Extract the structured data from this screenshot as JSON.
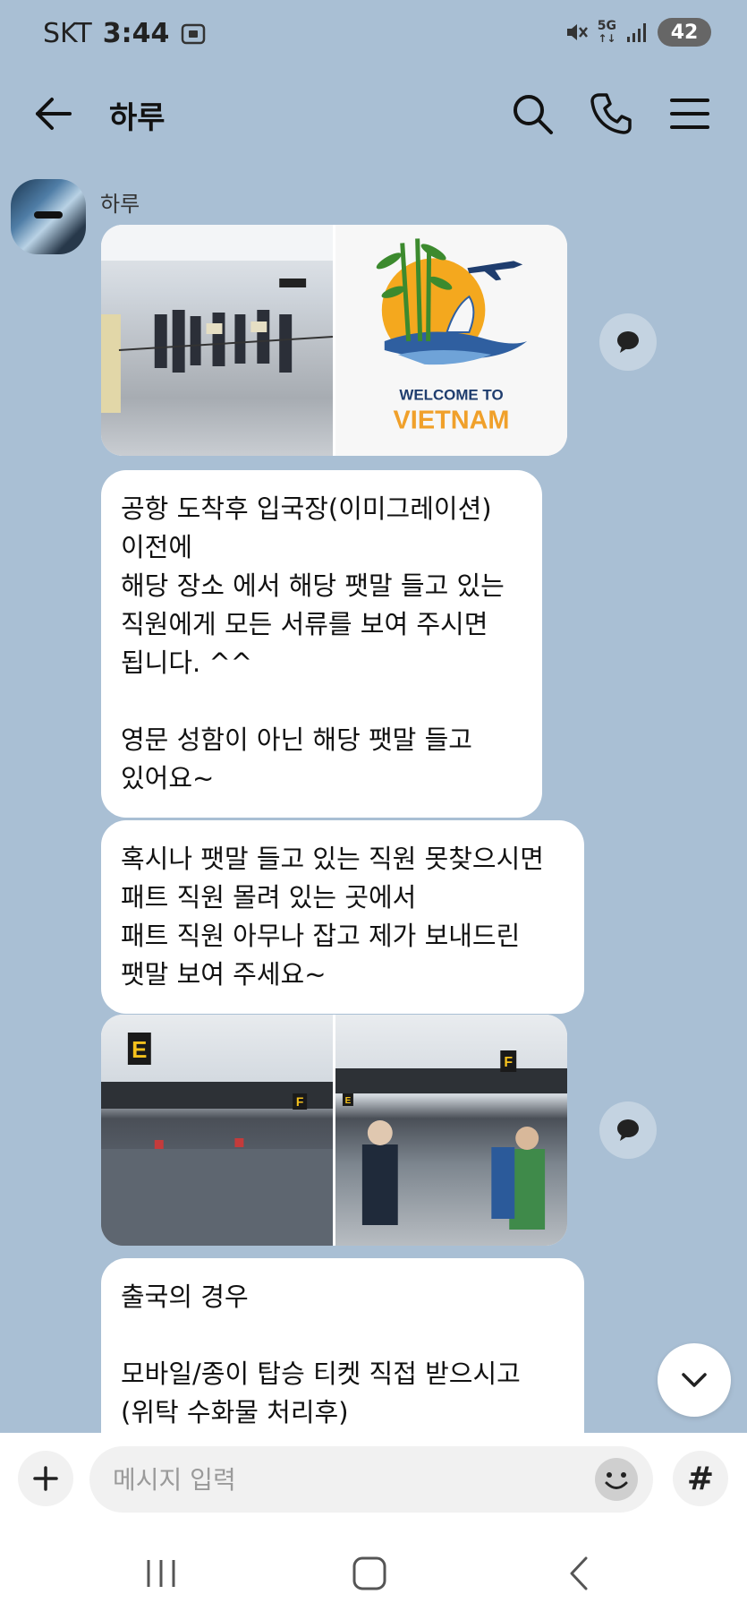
{
  "status_bar": {
    "carrier": "SKT",
    "time": "3:44",
    "network": "5G",
    "battery": "42",
    "icons": [
      "screenshot-icon",
      "mute-icon",
      "5g-icon",
      "signal-icon",
      "battery-icon"
    ]
  },
  "header": {
    "title": "하루",
    "icons": [
      "back-arrow-icon",
      "search-icon",
      "phone-icon",
      "menu-icon"
    ]
  },
  "chat": {
    "sender_name": "하루",
    "messages": [
      {
        "type": "images",
        "count": 2,
        "captions": [
          "",
          "WELCOME TO",
          "VIETNAM"
        ]
      },
      {
        "type": "text",
        "text": "공항 도착후 입국장(이미그레이션)\n이전에\n해당 장소 에서 해당 팻말 들고 있는\n직원에게 모든 서류를 보여 주시면\n됩니다. ^^\n\n영문 성함이 아닌 해당 팻말 들고\n있어요~"
      },
      {
        "type": "text",
        "text": "혹시나 팻말 들고 있는 직원 못찾으시면\n패트 직원 몰려 있는 곳에서\n패트 직원 아무나 잡고 제가 보내드린\n팻말 보여 주세요~"
      },
      {
        "type": "images",
        "count": 2,
        "signs": [
          "E",
          "F",
          "E",
          "F"
        ]
      },
      {
        "type": "text",
        "text": "출국의 경우\n\n모바일/종이 탑승 티켓 직접 받으시고\n(위탁 수화물 처리후)"
      }
    ]
  },
  "input_bar": {
    "placeholder": "메시지 입력",
    "hash_label": "#"
  },
  "nav_bar": {
    "icons": [
      "recent-apps-icon",
      "home-icon",
      "back-icon"
    ]
  },
  "colors": {
    "chat_background": "#a9bfd4",
    "bubble": "#ffffff",
    "vietnam_text": "#f0a02a",
    "welcome_text": "#1f3d6e"
  }
}
